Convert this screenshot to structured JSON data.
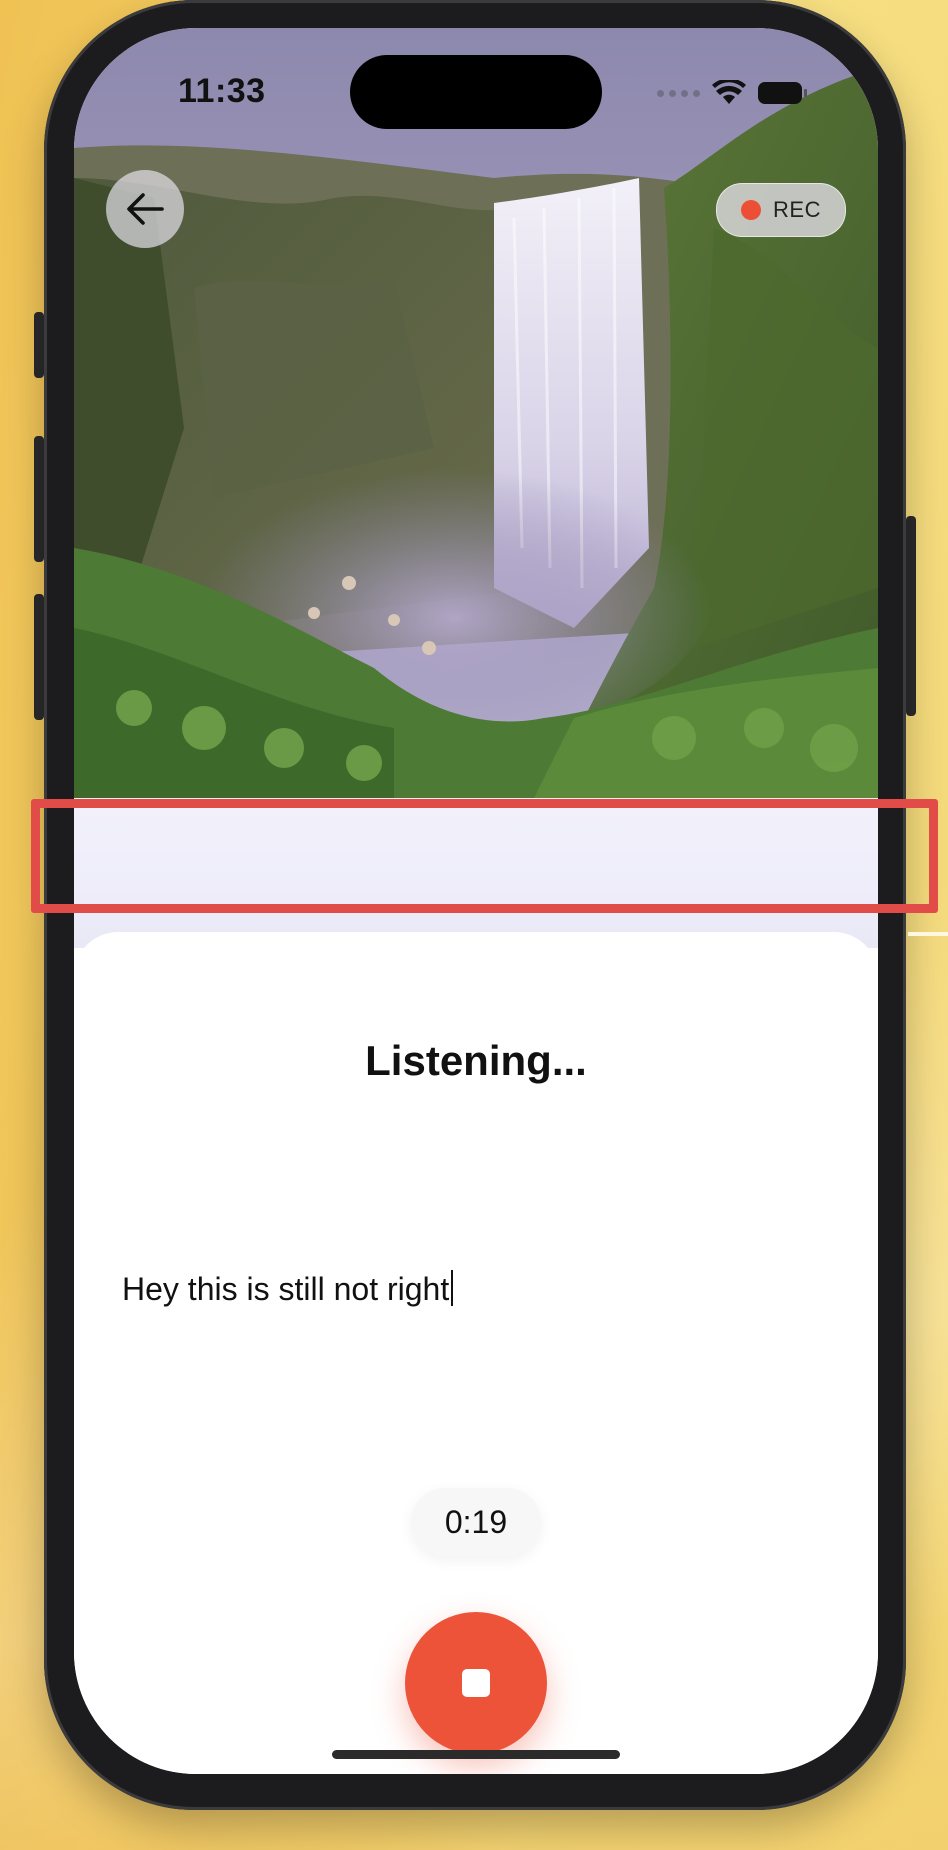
{
  "status_bar": {
    "time": "11:33"
  },
  "navigation": {
    "back_icon": "arrow-left-icon"
  },
  "recording_badge": {
    "label": "REC",
    "dot_color": "#ec4f35"
  },
  "sheet": {
    "title": "Listening...",
    "transcript": "Hey this is still not right",
    "timer": "0:19",
    "stop_icon": "stop-icon"
  },
  "colors": {
    "accent": "#ec5339",
    "highlight": "#e14b48",
    "panel": "#eeedf9"
  }
}
